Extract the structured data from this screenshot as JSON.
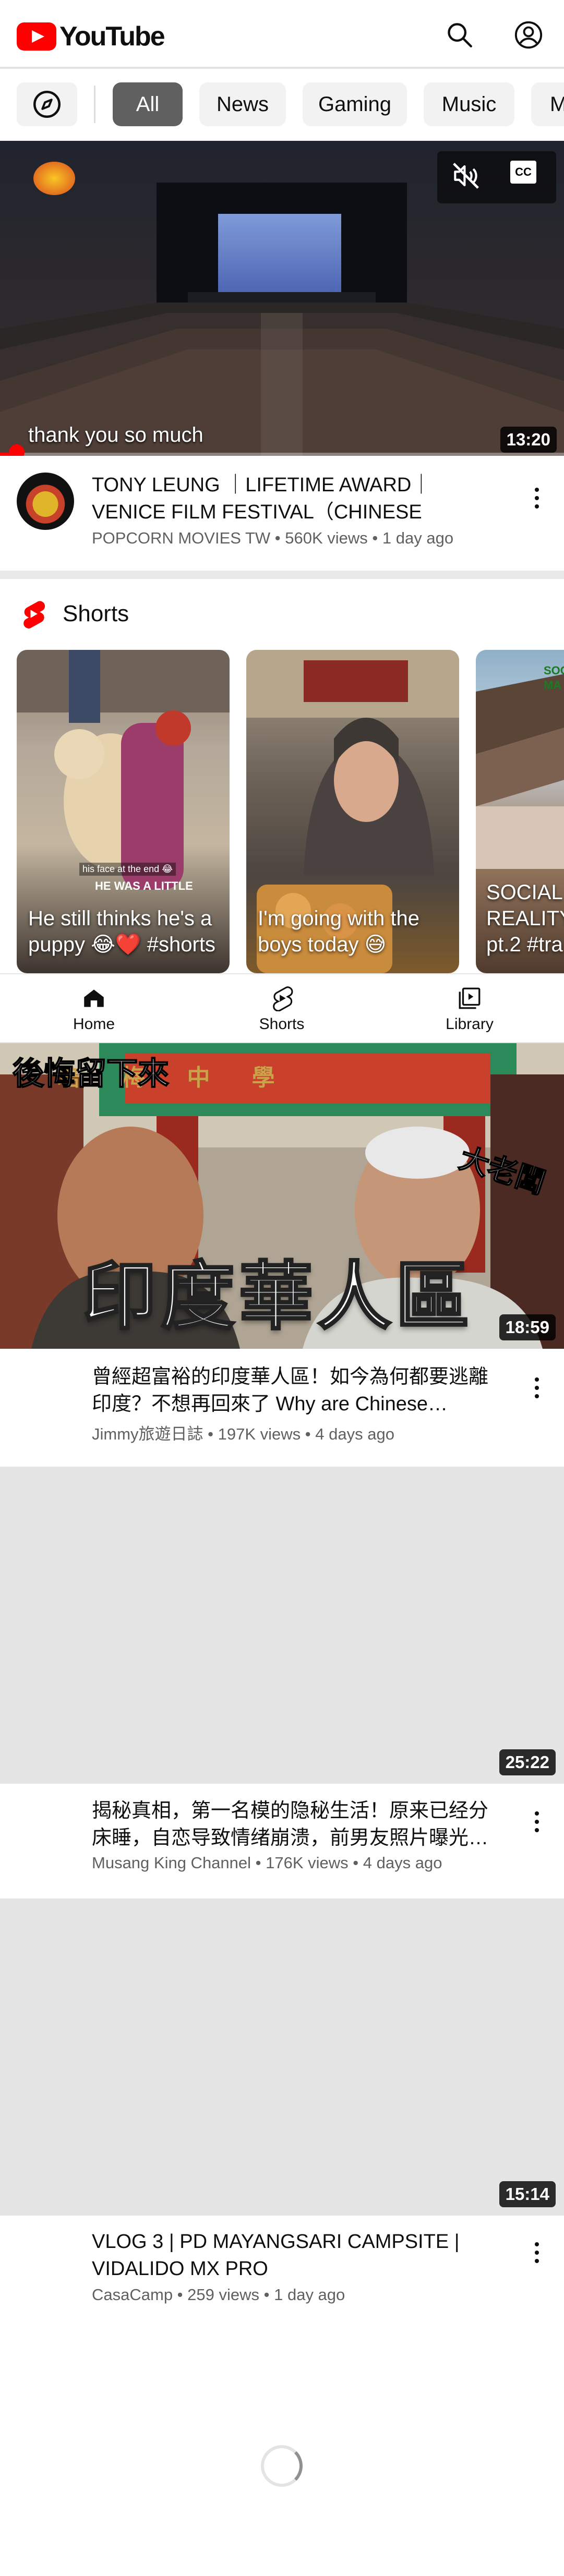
{
  "header": {
    "logo_text": "YouTube",
    "search_icon": "search-icon",
    "account_icon": "account-icon"
  },
  "chips": [
    {
      "label": "All",
      "active": true
    },
    {
      "label": "News"
    },
    {
      "label": "Gaming"
    },
    {
      "label": "Music"
    },
    {
      "label": "M"
    }
  ],
  "featured": {
    "caption": "thank you so much",
    "duration": "13:20",
    "title": "TONY LEUNG ｜LIFETIME AWARD｜VENICE FILM FESTIVAL（CHINESE SUBTITLES）",
    "channel": "POPCORN MOVIES TW",
    "views": "560K views",
    "age": "1 day ago",
    "progress_fraction": 0.02,
    "cc_label": "CC"
  },
  "shorts": {
    "heading": "Shorts",
    "items": [
      {
        "title": "He still thinks he's a puppy 😂❤️ #shorts",
        "overlay_top": "his face at the end 😂",
        "overlay_mid": "HE WAS A LITTLE"
      },
      {
        "title": "I'm going with the boys today 😅"
      },
      {
        "title": "SOCIAL REALITY pt.2 #tra",
        "overlay_top": "SOC MA"
      }
    ]
  },
  "bottom_nav": [
    {
      "label": "Home",
      "icon": "home-icon"
    },
    {
      "label": "Shorts",
      "icon": "shorts-icon"
    },
    {
      "label": "Library",
      "icon": "library-icon"
    }
  ],
  "videos": [
    {
      "thumb_text_main": "印度華人區",
      "thumb_text_top": "後悔留下來",
      "thumb_text_right": "大老闆",
      "thumb_sign": "培 梅 中 學",
      "duration": "18:59",
      "title": "曾經超富裕的印度華人區！如今為何都要逃離印度？不想再回來了 Why are Chinese…",
      "channel": "Jimmy旅遊日誌",
      "views": "197K views",
      "age": "4 days ago"
    },
    {
      "duration": "25:22",
      "title": "揭秘真相，第一名模的隐秘生活！原来已经分床睡，自恋导致情绪崩溃，前男友照片曝光…",
      "channel": "Musang King Channel",
      "views": "176K views",
      "age": "4 days ago"
    },
    {
      "duration": "15:14",
      "title": "VLOG 3 | PD MAYANGSARI CAMPSITE | VIDALIDO MX PRO",
      "channel": "CasaCamp",
      "views": "259 views",
      "age": "1 day ago"
    }
  ]
}
